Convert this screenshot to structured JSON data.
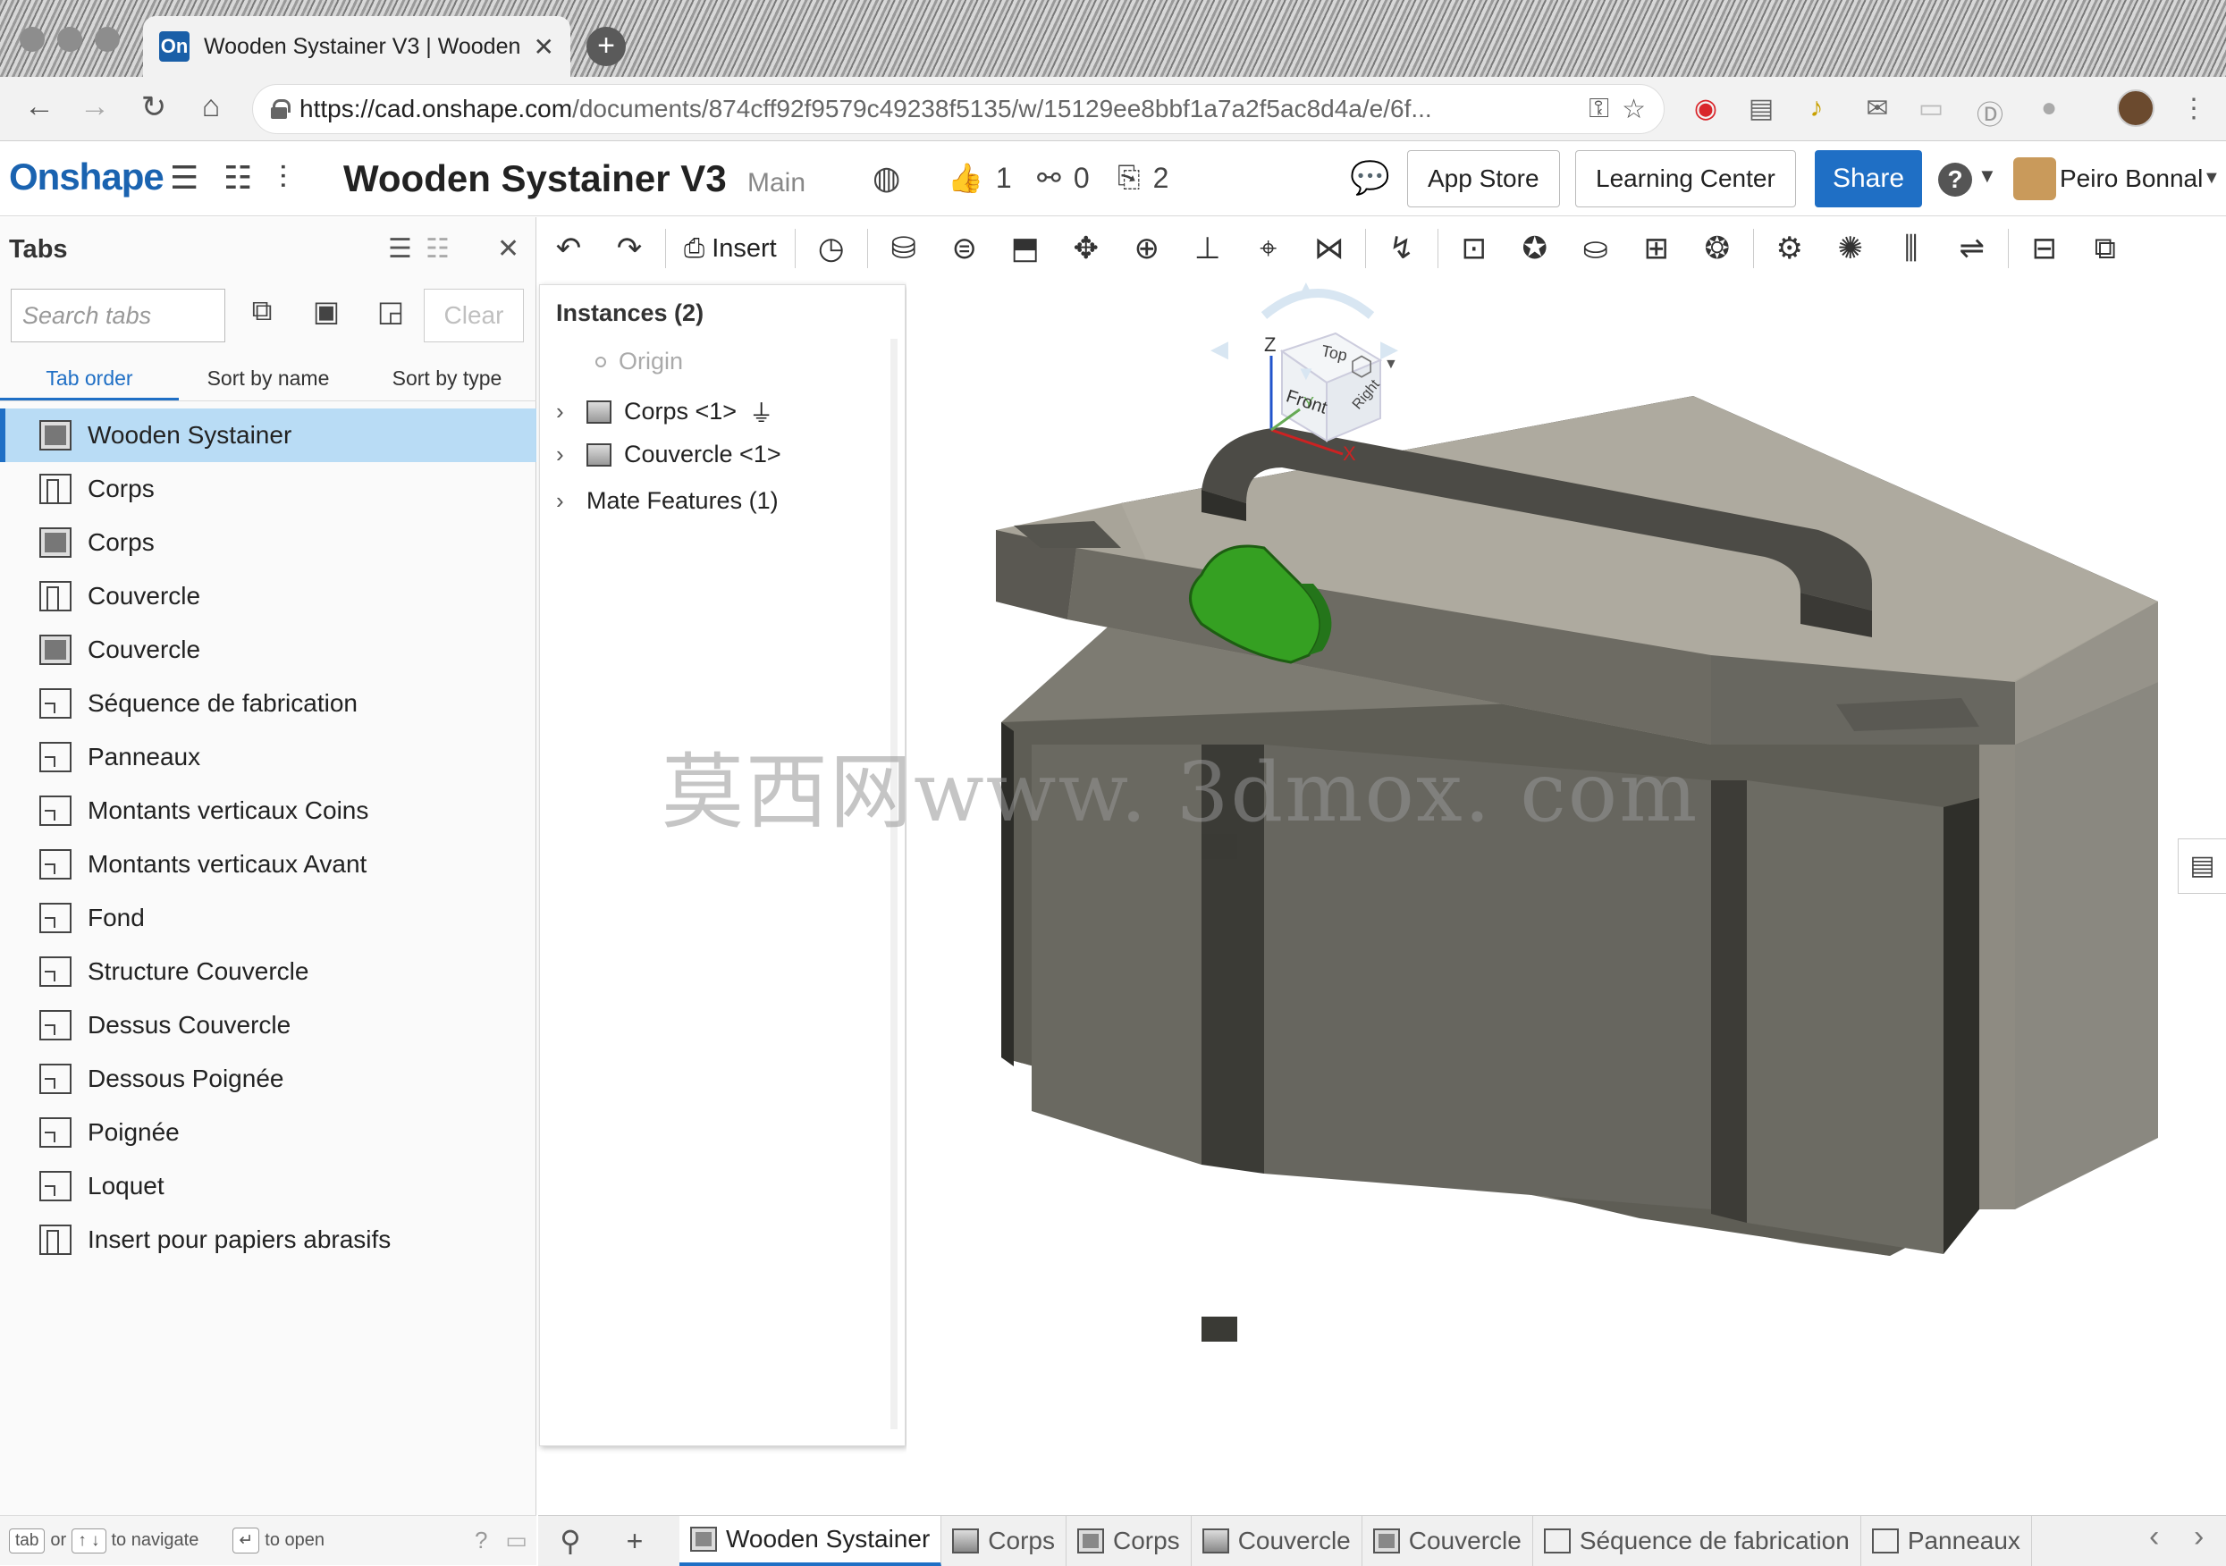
{
  "browser": {
    "tab_title": "Wooden Systainer V3 | Wooden...",
    "favicon_text": "On",
    "url_host": "https://cad.onshape.com",
    "url_path": "/documents/874cff92f9579c49238f5135/w/15129ee8bbf1a7a2f5ac8d4a/e/6f..."
  },
  "header": {
    "logo": "Onshape",
    "doc_title": "Wooden Systainer V3",
    "branch": "Main",
    "likes": "1",
    "links": "0",
    "copies": "2",
    "app_store": "App Store",
    "learning_center": "Learning Center",
    "share": "Share",
    "help": "?",
    "user": "Peiro Bonnal"
  },
  "tabs_panel": {
    "title": "Tabs",
    "search_placeholder": "Search tabs",
    "clear": "Clear",
    "sort_tabs": [
      "Tab order",
      "Sort by name",
      "Sort by type"
    ],
    "items": [
      {
        "label": "Wooden Systainer",
        "type": "assembly"
      },
      {
        "label": "Corps",
        "type": "partstudio"
      },
      {
        "label": "Corps",
        "type": "assembly"
      },
      {
        "label": "Couvercle",
        "type": "partstudio"
      },
      {
        "label": "Couvercle",
        "type": "assembly"
      },
      {
        "label": "Séquence de fabrication",
        "type": "drawing"
      },
      {
        "label": "Panneaux",
        "type": "drawing"
      },
      {
        "label": "Montants verticaux Coins",
        "type": "drawing"
      },
      {
        "label": "Montants verticaux Avant",
        "type": "drawing"
      },
      {
        "label": "Fond",
        "type": "drawing"
      },
      {
        "label": "Structure Couvercle",
        "type": "drawing"
      },
      {
        "label": "Dessus Couvercle",
        "type": "drawing"
      },
      {
        "label": "Dessous Poignée",
        "type": "drawing"
      },
      {
        "label": "Poignée",
        "type": "drawing"
      },
      {
        "label": "Loquet",
        "type": "drawing"
      },
      {
        "label": "Insert pour papiers abrasifs",
        "type": "partstudio"
      }
    ],
    "footer": {
      "key_tab": "tab",
      "or": "or",
      "key_arrows": "↑ ↓",
      "navigate": "to navigate",
      "key_enter": "↵",
      "open": "to open"
    }
  },
  "toolbar": {
    "insert": "Insert"
  },
  "instances": {
    "title": "Instances (2)",
    "origin": "Origin",
    "rows": [
      "Corps <1>",
      "Couvercle <1>",
      "Mate Features (1)"
    ]
  },
  "view_cube": {
    "top": "Top",
    "front": "Front",
    "right": "Right",
    "axis_z": "Z",
    "axis_x": "X",
    "axis_y": "Y"
  },
  "watermark": "莫西网www. 3dmox. com",
  "bottom_tabs": [
    {
      "label": "Wooden Systainer",
      "type": "assembly"
    },
    {
      "label": "Corps",
      "type": "partstudio"
    },
    {
      "label": "Corps",
      "type": "assembly"
    },
    {
      "label": "Couvercle",
      "type": "partstudio"
    },
    {
      "label": "Couvercle",
      "type": "assembly"
    },
    {
      "label": "Séquence de fabrication",
      "type": "drawing"
    },
    {
      "label": "Panneaux",
      "type": "drawing"
    }
  ],
  "colors": {
    "accent": "#1f6fc5",
    "selected_tab_bg": "#b9dcf5",
    "model_body": "#6a6960",
    "model_lid": "#9b978c",
    "latch": "#3a9d23"
  }
}
